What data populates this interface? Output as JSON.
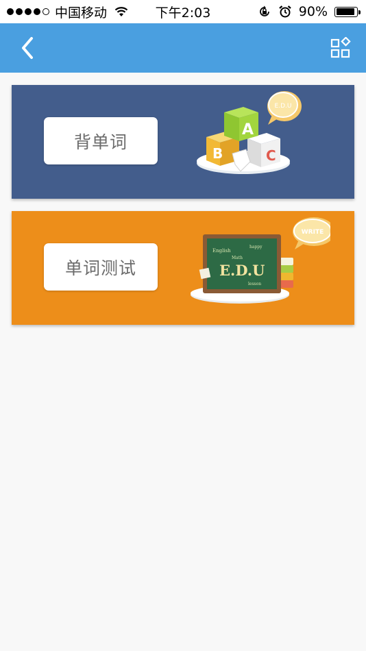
{
  "status_bar": {
    "signal_dots_filled": 4,
    "signal_dots_total": 5,
    "carrier": "中国移动",
    "time": "下午2:03",
    "battery_percent": "90%",
    "battery_level": 0.9
  },
  "nav": {
    "back_icon": "chevron-left-icon",
    "menu_icon": "apps-grid-icon",
    "color": "#4a9fe0"
  },
  "cards": [
    {
      "label": "背单词",
      "bg_color": "#435d8c",
      "illustration": {
        "bubble": "E.D.U",
        "blocks": [
          "A",
          "B",
          "C"
        ]
      }
    },
    {
      "label": "单词测试",
      "bg_color": "#ed8e1a",
      "illustration": {
        "bubble": "WRITE",
        "board_words": [
          "English",
          "happy",
          "Math",
          "E.D.U",
          "lesson"
        ]
      }
    }
  ]
}
